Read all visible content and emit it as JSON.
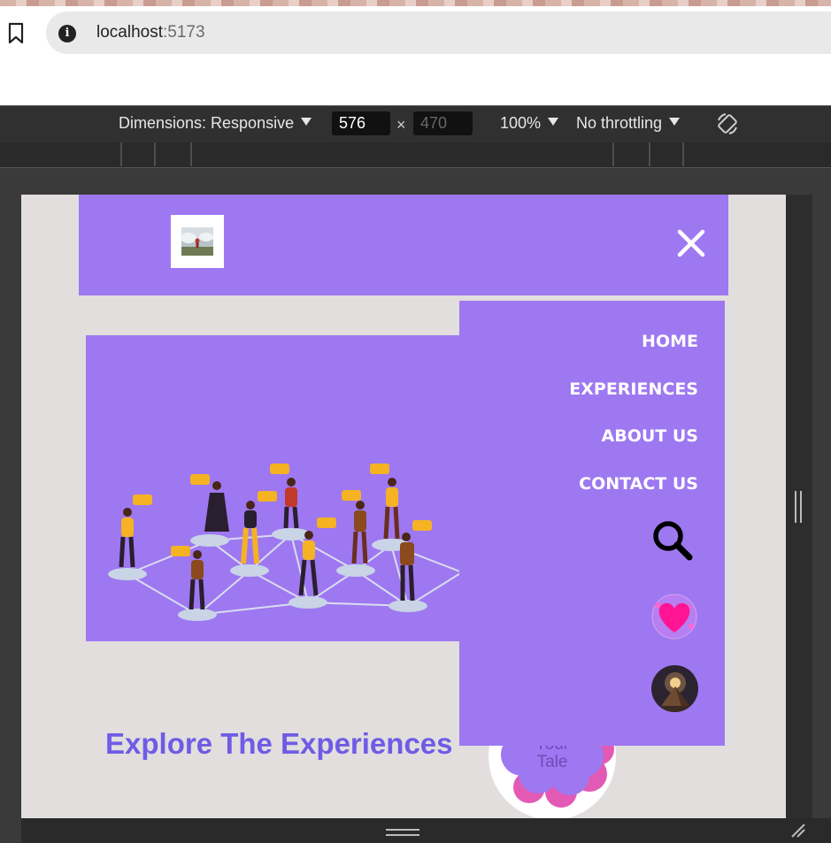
{
  "browser": {
    "url_host": "localhost",
    "url_port": ":5173"
  },
  "devtools": {
    "dimensions_label": "Dimensions: Responsive",
    "width": "576",
    "height": "470",
    "times": "×",
    "zoom": "100%",
    "throttling": "No throttling"
  },
  "site": {
    "nav": {
      "items": [
        "HOME",
        "EXPERIENCES",
        "ABOUT US",
        "CONTACT US"
      ]
    },
    "heading": "Explore The Experiences",
    "badge_lines": [
      "Your",
      "Tale"
    ]
  },
  "colors": {
    "brand_purple": "#9e78f1",
    "heading_purple": "#6e5ce6",
    "page_bg": "#e1dedd",
    "heart_pink": "#ff1493"
  },
  "icons": [
    "bookmark-icon",
    "info-icon",
    "rotate-icon",
    "close-icon",
    "search-icon",
    "heart-icon",
    "avatar"
  ]
}
